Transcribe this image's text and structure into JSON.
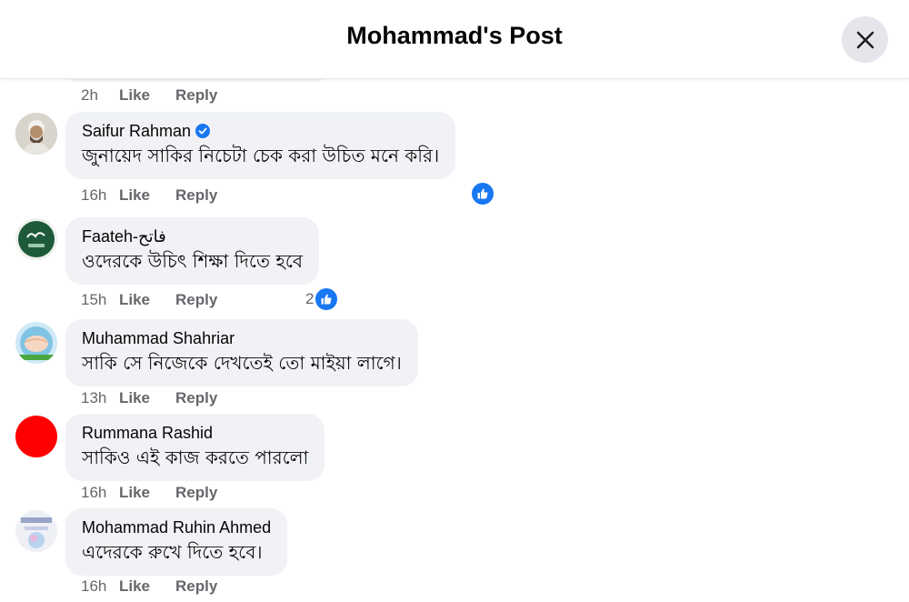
{
  "header": {
    "title": "Mohammad's Post"
  },
  "prev_meta": {
    "time": "2h",
    "like": "Like",
    "reply": "Reply"
  },
  "comments": [
    {
      "name": "Saifur Rahman",
      "verified": true,
      "text": "জুনায়েদ সাকির নিচেটা চেক করা উচিত মনে করি।",
      "time": "16h",
      "like": "Like",
      "reply": "Reply",
      "reactions": ""
    },
    {
      "name": "Faateh-فاتح",
      "verified": false,
      "text": "ওদেরকে উচিৎ শিক্ষা দিতে হবে",
      "time": "15h",
      "like": "Like",
      "reply": "Reply",
      "reactions": "2"
    },
    {
      "name": "Muhammad Shahriar",
      "verified": false,
      "text": "সাকি সে নিজেকে দেখতেই তো মাইয়া লাগে।",
      "time": "13h",
      "like": "Like",
      "reply": "Reply"
    },
    {
      "name": "Rummana Rashid",
      "verified": false,
      "text": "সাকিও এই কাজ করতে পারলো",
      "time": "16h",
      "like": "Like",
      "reply": "Reply"
    },
    {
      "name": "Mohammad Ruhin Ahmed",
      "verified": false,
      "text": "এদেরকে রুখে দিতে হবে।",
      "time": "16h",
      "like": "Like",
      "reply": "Reply"
    }
  ],
  "colors": {
    "accent": "#1877f2",
    "bubble": "#f0f2f5",
    "meta": "#65676b",
    "avatar_red": "#ff0000"
  },
  "icons": {
    "close": "close-icon",
    "verified": "verified-badge-icon",
    "like_reaction": "thumbs-up-icon"
  }
}
